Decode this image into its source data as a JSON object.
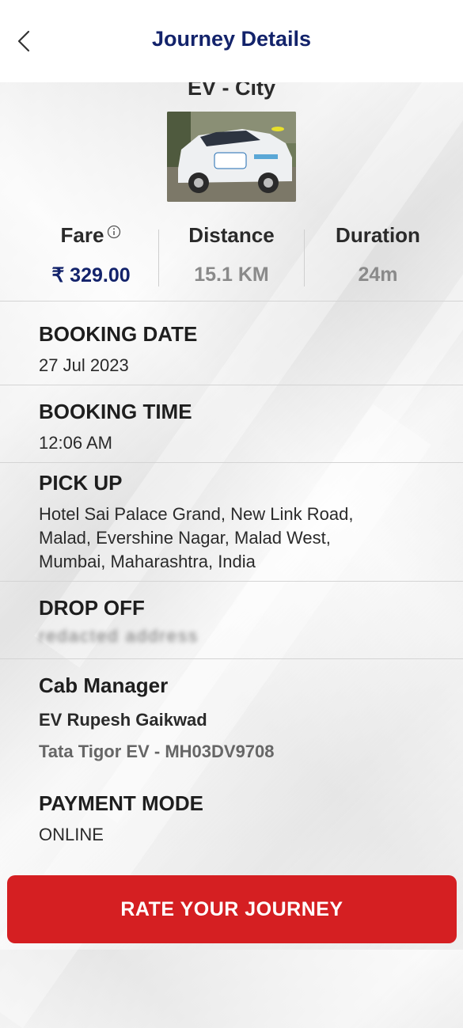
{
  "header": {
    "title": "Journey Details",
    "back_icon": "chevron-left-icon"
  },
  "vehicle": {
    "class_label": "EV - City",
    "image_alt": "White electric taxi car"
  },
  "stats": {
    "fare_label": "Fare",
    "fare_value": "₹ 329.00",
    "distance_label": "Distance",
    "distance_value": "15.1 KM",
    "duration_label": "Duration",
    "duration_value": "24m",
    "fare_color": "#13236b",
    "muted_color": "#8a8a8a"
  },
  "booking_date": {
    "label": "BOOKING DATE",
    "value": "27 Jul 2023"
  },
  "booking_time": {
    "label": "BOOKING TIME",
    "value": "12:06 AM"
  },
  "pickup": {
    "label": "PICK UP",
    "line1": "Hotel Sai Palace Grand, New Link Road,",
    "line2": "Malad, Evershine Nagar, Malad West,",
    "line3": "Mumbai, Maharashtra, India"
  },
  "dropoff": {
    "label": "DROP OFF",
    "value": "redacted address"
  },
  "cab_manager": {
    "label": "Cab Manager",
    "driver": "EV Rupesh Gaikwad",
    "vehicle": "Tata Tigor EV - MH03DV9708"
  },
  "payment": {
    "label": "PAYMENT MODE",
    "value": "ONLINE"
  },
  "rate_button": {
    "label": "RATE YOUR JOURNEY",
    "color": "#d51f22"
  }
}
